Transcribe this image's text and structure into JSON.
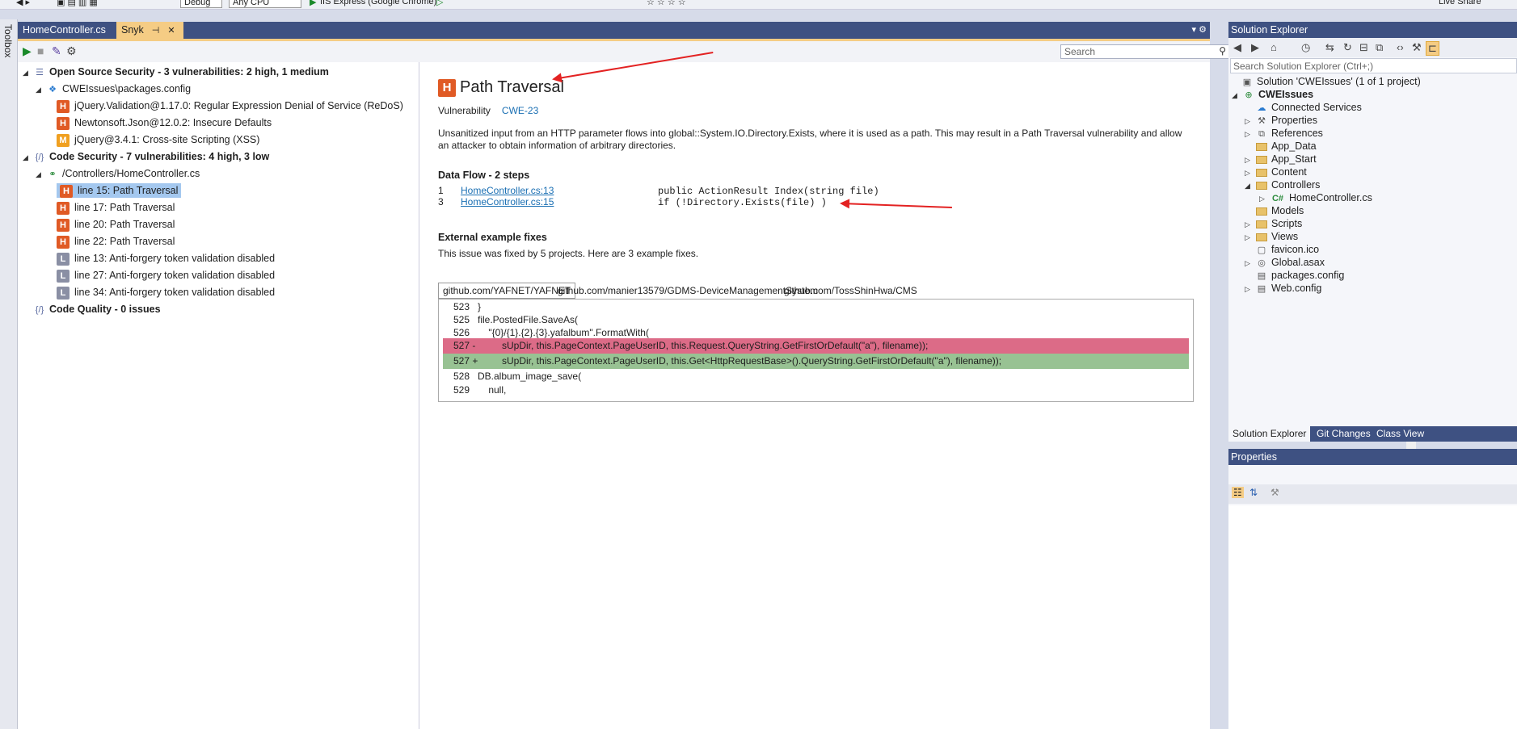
{
  "toolbar": {
    "config": "Debug",
    "platform": "Any CPU",
    "run_target": "IIS Express (Google Chrome)",
    "live_share": "Live Share"
  },
  "toolbox": {
    "label": "Toolbox"
  },
  "doc_tabs": [
    {
      "label": "HomeController.cs"
    },
    {
      "label": "Snyk"
    }
  ],
  "snyk": {
    "search_placeholder": "Search",
    "tree": {
      "oss_header": "Open Source Security - 3 vulnerabilities: 2 high, 1 medium",
      "oss_file": "CWEIssues\\packages.config",
      "oss_items": [
        {
          "label": "jQuery.Validation@1.17.0: Regular Expression Denial of Service (ReDoS)",
          "severity": "H"
        },
        {
          "label": "Newtonsoft.Json@12.0.2: Insecure Defaults",
          "severity": "H"
        },
        {
          "label": "jQuery@3.4.1: Cross-site Scripting (XSS)",
          "severity": "M"
        }
      ],
      "code_header": "Code Security - 7 vulnerabilities: 4 high, 3 low",
      "code_file": "/Controllers/HomeController.cs",
      "code_items": [
        {
          "label": "line 15: Path Traversal",
          "severity": "H"
        },
        {
          "label": "line 17: Path Traversal",
          "severity": "H"
        },
        {
          "label": "line 20: Path Traversal",
          "severity": "H"
        },
        {
          "label": "line 22: Path Traversal",
          "severity": "H"
        },
        {
          "label": "line 13: Anti-forgery token validation disabled",
          "severity": "L"
        },
        {
          "label": "line 27: Anti-forgery token validation disabled",
          "severity": "L"
        },
        {
          "label": "line 34: Anti-forgery token validation disabled",
          "severity": "L"
        }
      ],
      "quality_header": "Code Quality - 0 issues"
    },
    "detail": {
      "badge": "H",
      "title": "Path Traversal",
      "type": "Vulnerability",
      "cwe": "CWE-23",
      "description": "Unsanitized input from an HTTP parameter flows into global::System.IO.Directory.Exists, where it is used as a path. This may result in a Path Traversal vulnerability and allow an attacker to obtain information of arbitrary directories.",
      "dataflow_title": "Data Flow - 2 steps",
      "dataflow": [
        {
          "step": "1",
          "link": "HomeController.cs:13",
          "code": "public ActionResult Index(string file)"
        },
        {
          "step": "3",
          "link": "HomeController.cs:15",
          "code": "if (!Directory.Exists(file) )"
        }
      ],
      "fixes_title": "External example fixes",
      "fixes_note": "This issue was fixed by 5 projects. Here are 3 example fixes.",
      "fix_tabs": [
        {
          "label": "github.com/YAFNET/YAFNET"
        },
        {
          "label": "github.com/manier13579/GDMS-DeviceManagementSystem"
        },
        {
          "label": "github.com/TossShinHwa/CMS"
        }
      ],
      "diff": [
        {
          "ln": "523",
          "kind": "ctx",
          "code": "}"
        },
        {
          "ln": "525",
          "kind": "ctx",
          "code": "file.PostedFile.SaveAs("
        },
        {
          "ln": "526",
          "kind": "ctx",
          "code": "    \"{0}/{1}.{2}.{3}.yafalbum\".FormatWith("
        },
        {
          "ln": "527 -",
          "kind": "del",
          "code": "         sUpDir, this.PageContext.PageUserID, this.Request.QueryString.GetFirstOrDefault(\"a\"), filename));"
        },
        {
          "ln": "527 +",
          "kind": "add",
          "code": "         sUpDir, this.PageContext.PageUserID, this.Get<HttpRequestBase>().QueryString.GetFirstOrDefault(\"a\"), filename));"
        },
        {
          "ln": "528",
          "kind": "ctx",
          "code": "DB.album_image_save("
        },
        {
          "ln": "529",
          "kind": "ctx",
          "code": "    null,"
        }
      ]
    }
  },
  "solution_explorer": {
    "title": "Solution Explorer",
    "search_placeholder": "Search Solution Explorer (Ctrl+;)",
    "solution": "Solution 'CWEIssues' (1 of 1 project)",
    "project": "CWEIssues",
    "items": [
      {
        "label": "Connected Services",
        "icon": "cloud-icon",
        "expand": ""
      },
      {
        "label": "Properties",
        "icon": "wrench-icon",
        "expand": "▷"
      },
      {
        "label": "References",
        "icon": "references-icon",
        "expand": "▷"
      },
      {
        "label": "App_Data",
        "icon": "folder-icon",
        "expand": ""
      },
      {
        "label": "App_Start",
        "icon": "folder-icon",
        "expand": "▷"
      },
      {
        "label": "Content",
        "icon": "folder-icon",
        "expand": "▷"
      },
      {
        "label": "Controllers",
        "icon": "folder-icon",
        "expand": "◢"
      },
      {
        "label": "HomeController.cs",
        "icon": "csharp-icon",
        "expand": "▷"
      },
      {
        "label": "Models",
        "icon": "folder-icon",
        "expand": ""
      },
      {
        "label": "Scripts",
        "icon": "folder-icon",
        "expand": "▷"
      },
      {
        "label": "Views",
        "icon": "folder-icon",
        "expand": "▷"
      },
      {
        "label": "favicon.ico",
        "icon": "file-icon",
        "expand": ""
      },
      {
        "label": "Global.asax",
        "icon": "file-icon",
        "expand": "▷"
      },
      {
        "label": "packages.config",
        "icon": "file-icon",
        "expand": ""
      },
      {
        "label": "Web.config",
        "icon": "file-icon",
        "expand": "▷"
      }
    ],
    "bottom_tabs": [
      {
        "label": "Solution Explorer"
      },
      {
        "label": "Git Changes"
      },
      {
        "label": "Class View"
      }
    ]
  },
  "properties": {
    "title": "Properties"
  },
  "colors": {
    "accent_tab": "#f5cc84",
    "title_bar": "#3e5182",
    "severity_high": "#e05a25",
    "severity_medium": "#f0a020",
    "severity_low": "#8a8fa4",
    "diff_removed": "#dc6b87",
    "diff_added": "#98c293",
    "annotation": "#e32222"
  }
}
